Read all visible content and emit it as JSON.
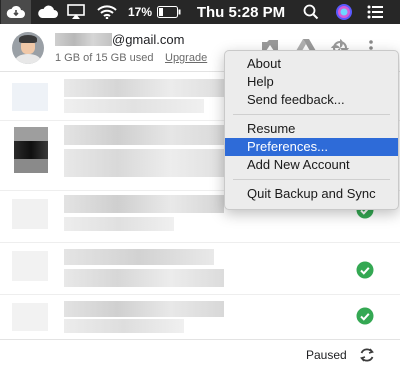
{
  "menubar": {
    "battery_percent": "17%",
    "clock": "Thu 5:28 PM",
    "icons": [
      "google-drive-cloud-icon",
      "cloud-icon",
      "airplay-icon",
      "wifi-icon",
      "battery-icon",
      "search-icon",
      "siri-icon",
      "notification-center-icon"
    ]
  },
  "account": {
    "email_domain": "@gmail.com",
    "storage": "1 GB of 15 GB used",
    "upgrade_label": "Upgrade"
  },
  "header_icons": [
    "photos-icon",
    "google-drive-icon",
    "pinwheel-icon",
    "more-vert-icon"
  ],
  "files": [
    {
      "status": "",
      "status_icon": ""
    },
    {
      "status": "",
      "status_icon": ""
    },
    {
      "status": "",
      "status_icon": "check-circle-icon"
    },
    {
      "status": "",
      "status_icon": "check-circle-icon"
    },
    {
      "status": "",
      "status_icon": "check-circle-icon"
    }
  ],
  "footer": {
    "status": "Paused",
    "status_icon": "sync-icon"
  },
  "menu": {
    "items": [
      {
        "label": "About"
      },
      {
        "label": "Help"
      },
      {
        "label": "Send feedback..."
      },
      {
        "label": "Resume"
      },
      {
        "label": "Preferences..."
      },
      {
        "label": "Add New Account"
      },
      {
        "label": "Quit Backup and Sync"
      }
    ],
    "active_item": "Preferences..."
  },
  "colors": {
    "menubar_bg": "#272727",
    "menu_highlight": "#2e6bd8",
    "check_green": "#34a853"
  }
}
